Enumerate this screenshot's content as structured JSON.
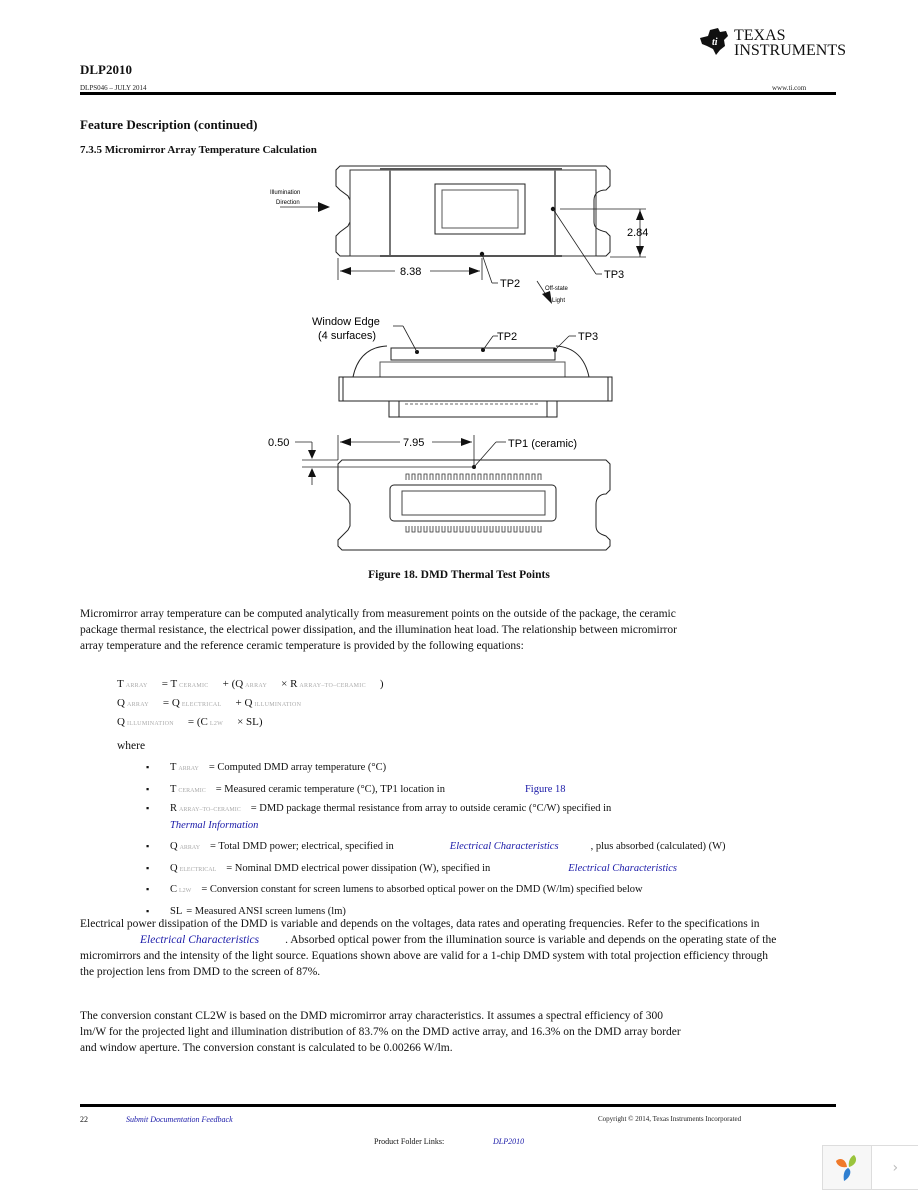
{
  "header": {
    "doc_title": "DLP2010",
    "doc_id_date": "DLPS046 – JULY 2014",
    "brand_line1": "Texas",
    "brand_line2": "Instruments",
    "url": "www.ti.com"
  },
  "section": {
    "title": "Feature Description (continued)",
    "subsection": "7.3.5 Micromirror Array Temperature Calculation"
  },
  "figure": {
    "caption": "Figure 18. DMD Thermal Test Points",
    "labels": {
      "illumination_line1": "Illumination",
      "illumination_line2": "Direction",
      "dim_838": "8.38",
      "dim_284": "2.84",
      "tp2": "TP2",
      "tp3": "TP3",
      "offstate_line1": "Off-state",
      "offstate_line2": "Light",
      "window_edge_line1": "Window Edge",
      "window_edge_line2": "(4 surfaces)",
      "dim_050": "0.50",
      "dim_795": "7.95",
      "tp1": "TP1 (ceramic)"
    }
  },
  "body": {
    "para1": "Micromirror array temperature can be computed analytically from measurement points on the outside of the package, the ceramic package thermal resistance, the electrical power dissipation, and the illumination heat load. The relationship between micromirror array temperature and the reference ceramic temperature is provided by the following equations:",
    "equations": [
      {
        "lhs": "T",
        "lhs_sub": "ARRAY",
        "rhs_parts": [
          "= T",
          "CERAMIC",
          "+ (Q",
          "ARRAY",
          "× R",
          "ARRAY–TO–CERAMIC",
          ")"
        ]
      },
      {
        "lhs": "Q",
        "lhs_sub": "ARRAY",
        "rhs_parts": [
          "= Q",
          "ELECTRICAL",
          "+ Q",
          "ILLUMINATION"
        ]
      },
      {
        "lhs": "Q",
        "lhs_sub": "ILLUMINATION",
        "rhs_parts": [
          "= (C",
          "L2W",
          "× SL)"
        ]
      }
    ],
    "where": "where",
    "bullets": [
      {
        "sym": "T",
        "sub": "ARRAY",
        "text": "= Computed DMD array temperature (°C)"
      },
      {
        "sym": "T",
        "sub": "CERAMIC",
        "text": "= Measured ceramic temperature (°C), TP1 location in",
        "link": "Figure 18"
      },
      {
        "sym": "R",
        "sub": "ARRAY–TO–CERAMIC",
        "text": "= DMD package thermal resistance from array to outside ceramic (°C/W) specified in",
        "link": "Thermal Information"
      },
      {
        "sym": "Q",
        "sub": "ARRAY",
        "text": "= Total DMD power; electrical, specified in",
        "link": "Electrical Characteristics",
        "after": ", plus absorbed (calculated) (W)"
      },
      {
        "sym": "Q",
        "sub": "ELECTRICAL",
        "text": "= Nominal DMD electrical power dissipation (W), specified in",
        "link": "Electrical Characteristics"
      },
      {
        "sym": "C",
        "sub": "L2W",
        "text": "= Conversion constant for screen lumens to absorbed optical power on the DMD (W/lm) specified below"
      },
      {
        "sym": "SL",
        "sub": "",
        "text": "= Measured ANSI screen lumens (lm)"
      }
    ],
    "para2_before": "Electrical power dissipation of the DMD is variable and depends on the voltages, data rates and operating frequencies. Refer to the specifications in",
    "para2_link": "Electrical Characteristics",
    "para2_after": ". Absorbed optical power from the illumination source is variable and depends on the operating state of the micromirrors and the intensity of the light source. Equations shown above are valid for a 1-chip DMD system with total projection efficiency through the projection lens from DMD to the screen of 87%.",
    "para3": "The conversion constant CL2W is based on the DMD micromirror array characteristics. It assumes a spectral efficiency of 300 lm/W for the projected light and illumination distribution of 83.7% on the DMD active array, and 16.3% on the DMD array border and window aperture. The conversion constant is calculated to be 0.00266 W/lm."
  },
  "footer": {
    "page_number": "22",
    "feedback_link": "Submit Documentation Feedback",
    "copyright": "Copyright © 2014, Texas Instruments Incorporated",
    "folder_label": "Product Folder Links:",
    "folder_link": "DLP2010"
  },
  "widget": {
    "logo_icon": "colorful-leaf-logo",
    "next_icon": "chevron-right",
    "next_glyph": "›"
  }
}
